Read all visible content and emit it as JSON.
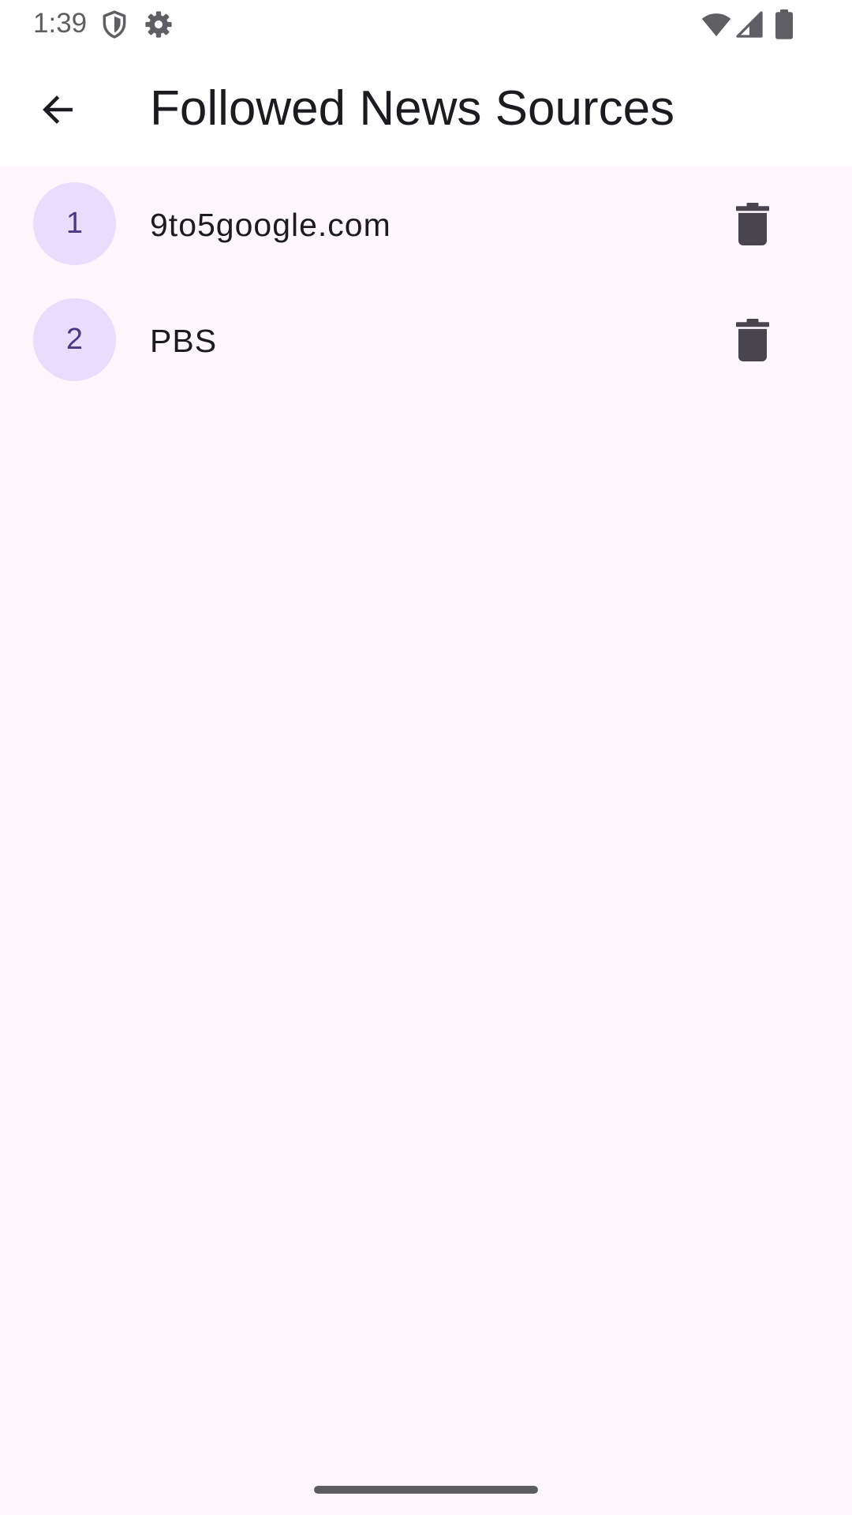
{
  "status_bar": {
    "time": "1:39",
    "icons": [
      "shield-icon",
      "gear-icon",
      "wifi-icon",
      "cell-signal-icon",
      "battery-icon"
    ]
  },
  "app_bar": {
    "back_icon": "arrow-back-icon",
    "title": "Followed News Sources"
  },
  "sources": [
    {
      "rank": "1",
      "name": "9to5google.com",
      "delete_icon": "trash-icon"
    },
    {
      "rank": "2",
      "name": "PBS",
      "delete_icon": "trash-icon"
    }
  ],
  "colors": {
    "background": "#FDF6FD",
    "app_bar": "#FFFFFF",
    "avatar_fill": "#E9DDFD",
    "avatar_text": "#4A3A86",
    "icon": "#49454F",
    "text": "#1C1B1F"
  }
}
